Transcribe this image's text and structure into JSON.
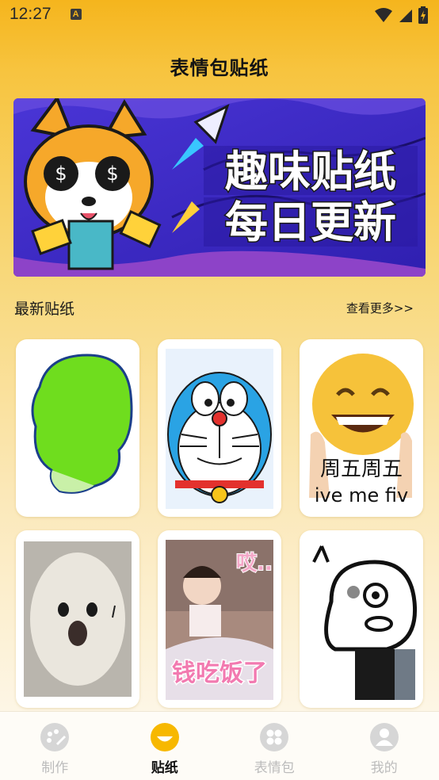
{
  "status_bar": {
    "time": "12:27",
    "indicator": "A"
  },
  "header": {
    "title": "表情包贴纸"
  },
  "banner": {
    "line1": "趣味贴纸",
    "line2": "每日更新",
    "accent": "#3b2cc9"
  },
  "latest": {
    "title": "最新贴纸",
    "more_label": "查看更多>>",
    "stickers": [
      {
        "name": "green-blob-sticker"
      },
      {
        "name": "doraemon-sticker"
      },
      {
        "name": "smile-emoji-sticker",
        "caption_line1": "周五周五",
        "caption_line2": "ive me fiv"
      },
      {
        "name": "seal-sticker"
      },
      {
        "name": "baby-sticker",
        "caption_top": "哎..",
        "caption_bottom": "钱吃饭了"
      },
      {
        "name": "doodle-sticker"
      }
    ]
  },
  "tabbar": {
    "tabs": [
      {
        "label": "制作",
        "active": false
      },
      {
        "label": "贴纸",
        "active": true
      },
      {
        "label": "表情包",
        "active": false
      },
      {
        "label": "我的",
        "active": false
      }
    ]
  },
  "colors": {
    "brand": "#f5b51d",
    "active_tab": "#f7b800",
    "inactive": "#bcbcbc"
  }
}
